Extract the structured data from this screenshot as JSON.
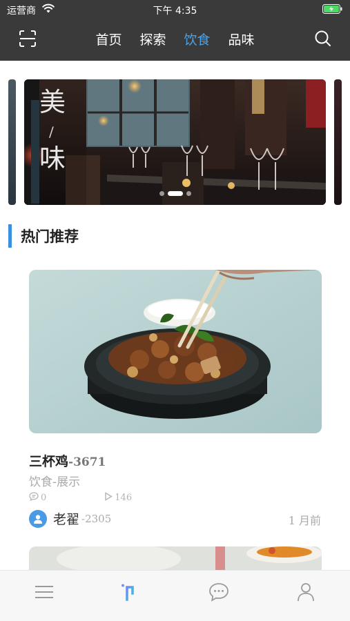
{
  "status_bar": {
    "carrier": "运营商",
    "time": "下午 4:35"
  },
  "nav": {
    "tabs": [
      {
        "label": "首页",
        "active": false
      },
      {
        "label": "探索",
        "active": false
      },
      {
        "label": "饮食",
        "active": true
      },
      {
        "label": "品味",
        "active": false
      }
    ],
    "icons": {
      "left": "scan-icon",
      "right": "search-icon"
    },
    "active_color": "#4da3e8",
    "background": "#3a3a3a"
  },
  "banner": {
    "text_top": "美",
    "text_mid": "/",
    "text_bottom": "味",
    "dot_count": 3,
    "active_dot": 1
  },
  "section": {
    "title": "热门推荐",
    "accent_color": "#3a8fde"
  },
  "card": {
    "title": "三杯鸡",
    "title_suffix": "-3671",
    "category": "饮食-展示",
    "comments": "0",
    "views": "146",
    "author": "老翟",
    "author_suffix": "-2305",
    "time_ago": "1 月前"
  },
  "tabbar": {
    "items": [
      "menu-icon",
      "logo-icon",
      "chat-icon",
      "profile-icon"
    ],
    "active_index": 1
  }
}
